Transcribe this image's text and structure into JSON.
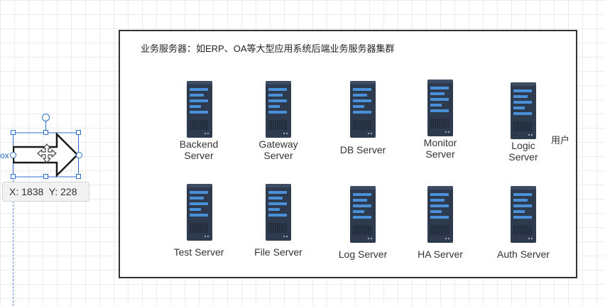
{
  "canvas": {
    "container_title": "业务服务器：如ERP、OA等大型应用系统后端业务服务器集群",
    "user_label": "用户",
    "servers_row1": [
      {
        "label_line1": "Backend",
        "label_line2": "Server"
      },
      {
        "label_line1": "Gateway",
        "label_line2": "Server"
      },
      {
        "label_line1": "DB Server",
        "label_line2": ""
      },
      {
        "label_line1": "Monitor",
        "label_line2": "Server"
      },
      {
        "label_line1": "Logic",
        "label_line2": "Server"
      }
    ],
    "servers_row2": [
      {
        "label": "Test Server"
      },
      {
        "label": "File Server"
      },
      {
        "label": "Log Server"
      },
      {
        "label": "HA Server"
      },
      {
        "label": "Auth Server"
      }
    ]
  },
  "selection": {
    "partial_label": "ox",
    "tooltip": "X: 1838  Y: 228"
  },
  "colors": {
    "server_body": "#2e3b4e",
    "server_slot": "#4a90d9",
    "selection_accent": "#2c6fcf"
  },
  "icons": [
    "server-icon",
    "move-cursor-icon",
    "rotate-handle-icon",
    "arrow-shape"
  ]
}
